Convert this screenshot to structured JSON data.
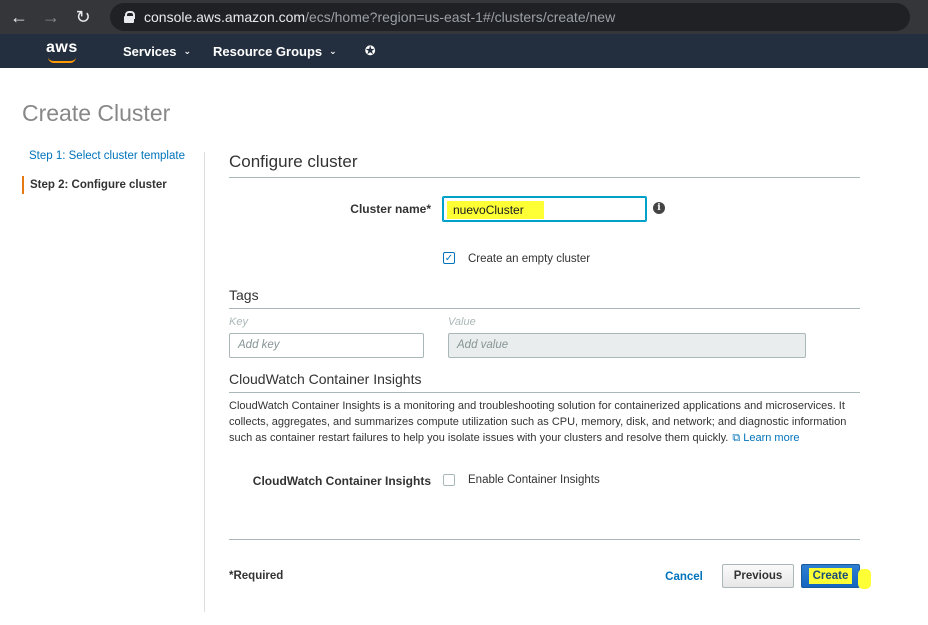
{
  "browser": {
    "url_host": "console.aws.amazon.com",
    "url_path": "/ecs/home?region=us-east-1#/clusters/create/new"
  },
  "aws_nav": {
    "logo_text": "aws",
    "services_label": "Services",
    "resource_groups_label": "Resource Groups",
    "pin_icon": "pin-icon"
  },
  "page": {
    "title": "Create Cluster"
  },
  "sidebar": {
    "steps": [
      {
        "label": "Step 1: Select cluster template",
        "active": false
      },
      {
        "label": "Step 2: Configure cluster",
        "active": true
      }
    ]
  },
  "configure": {
    "section_title": "Configure cluster",
    "cluster_name_label": "Cluster name*",
    "cluster_name_value": "nuevoCluster",
    "empty_cluster_label": "Create an empty cluster",
    "empty_cluster_checked": true
  },
  "tags": {
    "section_title": "Tags",
    "key_header": "Key",
    "value_header": "Value",
    "key_placeholder": "Add key",
    "value_placeholder": "Add value"
  },
  "insights": {
    "section_title": "CloudWatch Container Insights",
    "description": "CloudWatch Container Insights is a monitoring and troubleshooting solution for containerized applications and microservices. It collects, aggregates, and summarizes compute utilization such as CPU, memory, disk, and network; and diagnostic information such as container restart failures to help you isolate issues with your clusters and resolve them quickly.",
    "learn_more": "Learn more",
    "row_label": "CloudWatch Container Insights",
    "enable_label": "Enable Container Insights",
    "enable_checked": false
  },
  "footer": {
    "required_label": "*Required",
    "cancel_label": "Cancel",
    "previous_label": "Previous",
    "create_label": "Create"
  },
  "colors": {
    "link": "#0073bb",
    "accent": "#e47911",
    "highlight": "#ffff35",
    "nav_bg": "#232f3e"
  }
}
